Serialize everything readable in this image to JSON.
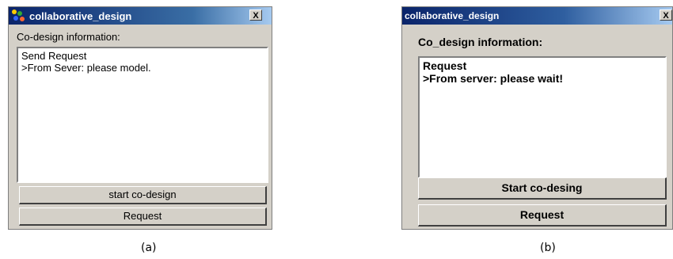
{
  "window_a": {
    "title": "collaborative_design",
    "close_label": "X",
    "info_label": "Co-design information:",
    "log_lines": [
      "Send Request",
      ">From Sever: please model."
    ],
    "start_button": "start co-design",
    "request_button": "Request",
    "caption": "(a)",
    "icon": "app-icon"
  },
  "window_b": {
    "title": "collaborative_design",
    "close_label": "X",
    "info_label": "Co_design information:",
    "log_lines": [
      "Request",
      ">From server: please wait!"
    ],
    "start_button": "Start co-desing",
    "request_button": "Request",
    "caption": "(b)"
  },
  "colors": {
    "title_bar": "#0a246a",
    "window_face": "#d4d0c8"
  }
}
